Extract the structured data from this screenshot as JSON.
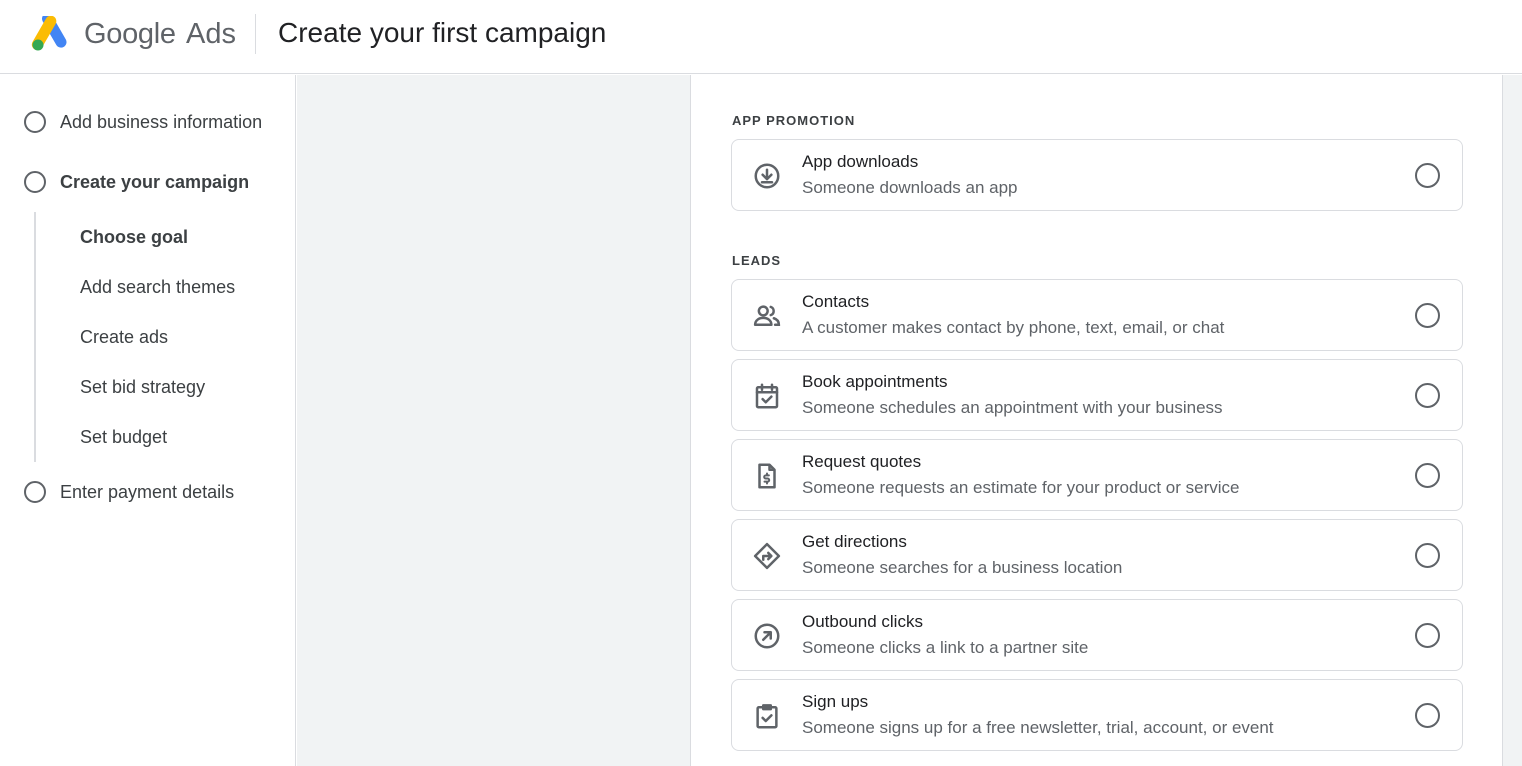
{
  "header": {
    "brand_google": "Google",
    "brand_ads": "Ads",
    "title": "Create your first campaign"
  },
  "sidebar": {
    "steps": [
      {
        "label": "Add business information"
      },
      {
        "label": "Create your campaign"
      },
      {
        "label": "Enter payment details"
      }
    ],
    "substeps": [
      {
        "label": "Choose goal"
      },
      {
        "label": "Add search themes"
      },
      {
        "label": "Create ads"
      },
      {
        "label": "Set bid strategy"
      },
      {
        "label": "Set budget"
      }
    ]
  },
  "sections": {
    "app_promotion": {
      "header": "APP PROMOTION",
      "options": [
        {
          "title": "App downloads",
          "desc": "Someone downloads an app",
          "icon": "download-circle-icon",
          "selected": false
        }
      ]
    },
    "leads": {
      "header": "LEADS",
      "options": [
        {
          "title": "Contacts",
          "desc": "A customer makes contact by phone, text, email, or chat",
          "icon": "people-icon",
          "selected": false
        },
        {
          "title": "Book appointments",
          "desc": "Someone schedules an appointment with your business",
          "icon": "calendar-check-icon",
          "selected": false
        },
        {
          "title": "Request quotes",
          "desc": "Someone requests an estimate for your product or service",
          "icon": "quote-document-icon",
          "selected": false
        },
        {
          "title": "Get directions",
          "desc": "Someone searches for a business location",
          "icon": "directions-icon",
          "selected": false
        },
        {
          "title": "Outbound clicks",
          "desc": "Someone clicks a link to a partner site",
          "icon": "outbound-arrow-icon",
          "selected": false
        },
        {
          "title": "Sign ups",
          "desc": "Someone signs up for a free newsletter, trial, account, or event",
          "icon": "clipboard-check-icon",
          "selected": false
        }
      ]
    }
  },
  "colors": {
    "logo_blue": "#4285F4",
    "logo_yellow": "#FBBC04",
    "logo_green": "#34A853",
    "icon_gray": "#5f6368",
    "panel_gray": "#f1f3f4"
  }
}
